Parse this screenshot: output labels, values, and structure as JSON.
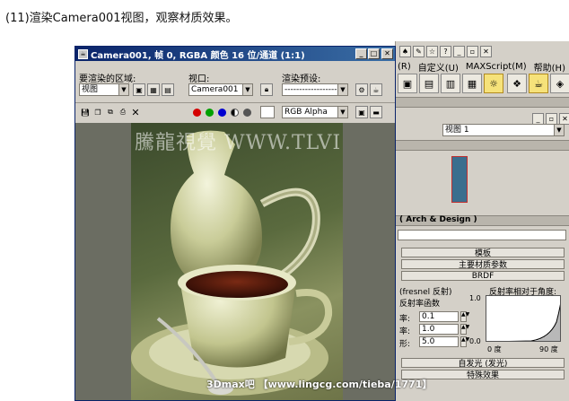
{
  "caption": "(11)渲染Camera001视图，观察材质效果。",
  "render_window": {
    "title": "Camera001, 帧 0, RGBA 颜色 16 位/通道 (1:1)",
    "area_label": "要渲染的区域:",
    "area_value": "视图",
    "viewport_label": "视口:",
    "viewport_value": "Camera001",
    "preset_label": "渲染预设:",
    "preset_value": "-------------------",
    "channel_value": "RGB Alpha",
    "watermark": "騰龍視覺 WWW.TLVI.NET"
  },
  "background_app": {
    "menu_items": [
      "(R)",
      "自定义(U)",
      "MAXScript(M)",
      "帮助(H)"
    ],
    "view_dropdown": "视图 1",
    "material_header": "( Arch & Design )",
    "rollouts": [
      "模板",
      "主要材质参数",
      "BRDF"
    ],
    "fresnel_label": "(fresnel 反射)",
    "curve_label": "反射率函数",
    "angle_label": "反射率相对于角度:",
    "spinner_rows": [
      {
        "label": "率:",
        "value": "0.1"
      },
      {
        "label": "率:",
        "value": "1.0"
      },
      {
        "label": "形:",
        "value": "5.0"
      }
    ],
    "graph": {
      "y_top": "1.0",
      "y_bottom": "0.0",
      "x_left": "0 度",
      "x_right": "90 度"
    },
    "bottom_rollouts": [
      "自发光 (发光)",
      "特殊效果"
    ]
  },
  "footer_watermark": "3Dmax吧  【www.lingcg.com/tieba/1771】",
  "colors": {
    "title_bar": "#0a246a",
    "ui_gray": "#d4d0c8",
    "swatch_blue": "#3a6e8e"
  }
}
